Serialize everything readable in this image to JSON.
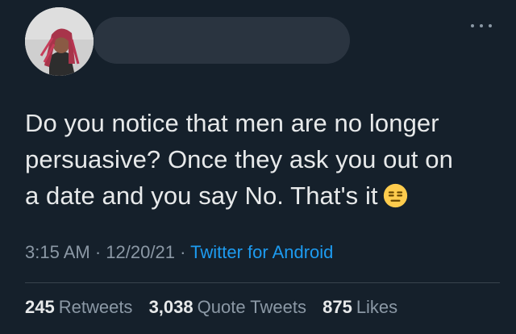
{
  "tweet": {
    "text_lines": [
      "Do you notice that men are no longer",
      "persuasive? Once they ask you out on",
      "a date and you say No. That's it"
    ],
    "emoji": "expressionless-face",
    "time": "3:15 AM",
    "date": "12/20/21",
    "separator": "·",
    "source": "Twitter for Android"
  },
  "stats": {
    "retweets_count": "245",
    "retweets_label": "Retweets",
    "quote_tweets_count": "3,038",
    "quote_tweets_label": "Quote Tweets",
    "likes_count": "875",
    "likes_label": "Likes"
  },
  "colors": {
    "background": "#15202b",
    "text": "#e7e9ea",
    "secondary": "#8b98a5",
    "link": "#1d9bf0"
  }
}
